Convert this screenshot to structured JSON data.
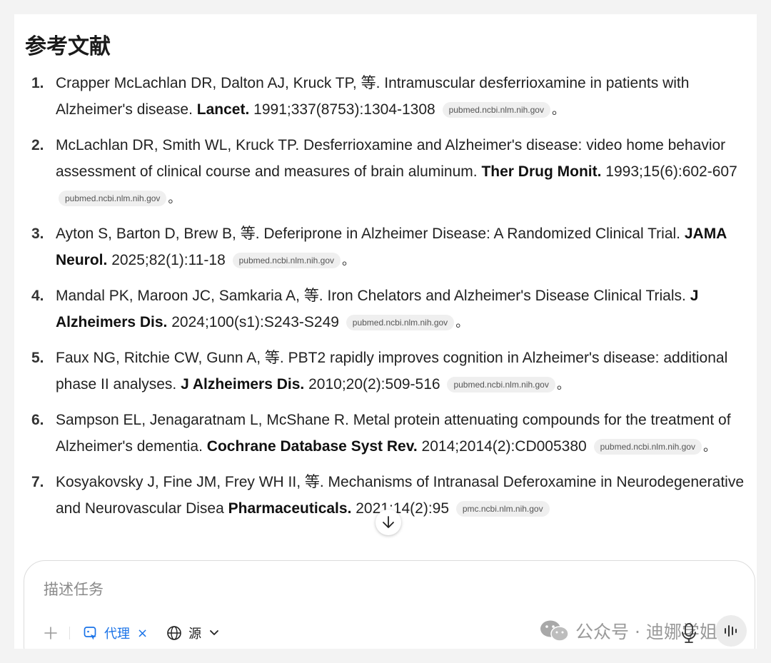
{
  "title": "参考文献",
  "references": [
    {
      "num": "1.",
      "authors_text": "Crapper McLachlan DR, Dalton AJ, Kruck TP, 等. Intramuscular desferrioxamine in patients with Alzheimer's disease.",
      "journal": "Lancet.",
      "citation": "1991;337(8753):1304-1308",
      "source": "pubmed.ncbi.nlm.nih.gov",
      "end": "。"
    },
    {
      "num": "2.",
      "authors_text": "McLachlan DR, Smith WL, Kruck TP. Desferrioxamine and Alzheimer's disease: video home behavior assessment of clinical course and measures of brain aluminum.",
      "journal": "Ther Drug Monit.",
      "citation": "1993;15(6):602-607",
      "source": "pubmed.ncbi.nlm.nih.gov",
      "end": "。"
    },
    {
      "num": "3.",
      "authors_text": "Ayton S, Barton D, Brew B, 等. Deferiprone in Alzheimer Disease: A Randomized Clinical Trial.",
      "journal": "JAMA Neurol.",
      "citation": "2025;82(1):11-18",
      "source": "pubmed.ncbi.nlm.nih.gov",
      "end": "。"
    },
    {
      "num": "4.",
      "authors_text": "Mandal PK, Maroon JC, Samkaria A, 等. Iron Chelators and Alzheimer's Disease Clinical Trials.",
      "journal": "J Alzheimers Dis.",
      "citation": "2024;100(s1):S243-S249",
      "source": "pubmed.ncbi.nlm.nih.gov",
      "end": "。"
    },
    {
      "num": "5.",
      "authors_text": "Faux NG, Ritchie CW, Gunn A, 等. PBT2 rapidly improves cognition in Alzheimer's disease: additional phase II analyses.",
      "journal": "J Alzheimers Dis.",
      "citation": "2010;20(2):509-516",
      "source": "pubmed.ncbi.nlm.nih.gov",
      "end": "。"
    },
    {
      "num": "6.",
      "authors_text": "Sampson EL, Jenagaratnam L, McShane R. Metal protein attenuating compounds for the treatment of Alzheimer's dementia.",
      "journal": "Cochrane Database Syst Rev.",
      "citation": "2014;2014(2):CD005380",
      "source": "pubmed.ncbi.nlm.nih.gov",
      "end": "。"
    },
    {
      "num": "7.",
      "authors_text": "Kosyakovsky J, Fine JM, Frey WH II, 等. Mechanisms of Intranasal Deferoxamine in Neurodegenerative and Neurovascular Disea",
      "journal": "Pharmaceuticals.",
      "citation": "2021;14(2):95",
      "source": "pmc.ncbi.nlm.nih.gov",
      "end": ""
    }
  ],
  "composer": {
    "placeholder": "描述任务",
    "agent_label": "代理",
    "agent_remove": "×",
    "source_label": "源"
  },
  "watermark": {
    "text": "公众号 · 迪娜学姐"
  },
  "icons": {
    "plus": "plus-icon",
    "agent": "agent-icon",
    "globe": "globe-icon",
    "chevron": "chevron-down-icon",
    "scroll": "arrow-down-icon",
    "mic": "mic-icon",
    "voice": "voice-wave-icon",
    "wechat": "wechat-icon"
  },
  "colors": {
    "accent": "#1a73e8",
    "chip_bg": "#efefef"
  }
}
